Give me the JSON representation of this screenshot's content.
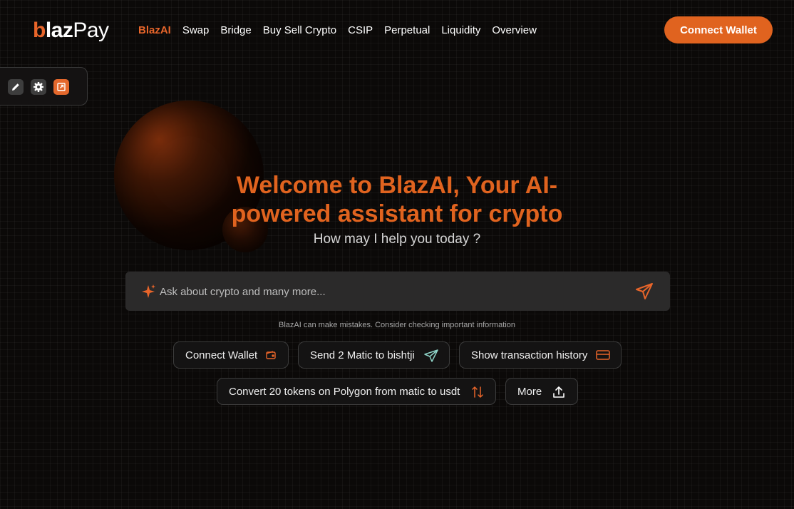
{
  "brand": {
    "logo_b": "b",
    "logo_laz": "laz",
    "logo_pay": "Pay",
    "accent": "#e0631f"
  },
  "nav": {
    "items": [
      {
        "label": "BlazAI",
        "active": true
      },
      {
        "label": "Swap"
      },
      {
        "label": "Bridge"
      },
      {
        "label": "Buy Sell Crypto"
      },
      {
        "label": "CSIP"
      },
      {
        "label": "Perpetual"
      },
      {
        "label": "Liquidity"
      },
      {
        "label": "Overview"
      }
    ]
  },
  "header": {
    "connect_wallet_label": "Connect Wallet"
  },
  "toolbar": {
    "icons": [
      "pencil-icon",
      "gear-icon",
      "external-link-icon"
    ]
  },
  "hero": {
    "title": "Welcome to BlazAI, Your AI-powered assistant for crypto",
    "subtitle": "How may I help you today ?"
  },
  "search": {
    "placeholder": "Ask about crypto and many more...",
    "value": ""
  },
  "disclaimer": "BlazAI can make mistakes. Consider checking important information",
  "suggestions": [
    {
      "label": "Connect Wallet",
      "icon": "wallet-icon"
    },
    {
      "label": "Send 2 Matic to bishtji",
      "icon": "send-icon"
    },
    {
      "label": "Show transaction history",
      "icon": "card-icon"
    },
    {
      "label": "Convert 20 tokens on Polygon from matic to usdt",
      "icon": "swap-arrows-icon"
    },
    {
      "label": "More",
      "icon": "upload-icon"
    }
  ]
}
